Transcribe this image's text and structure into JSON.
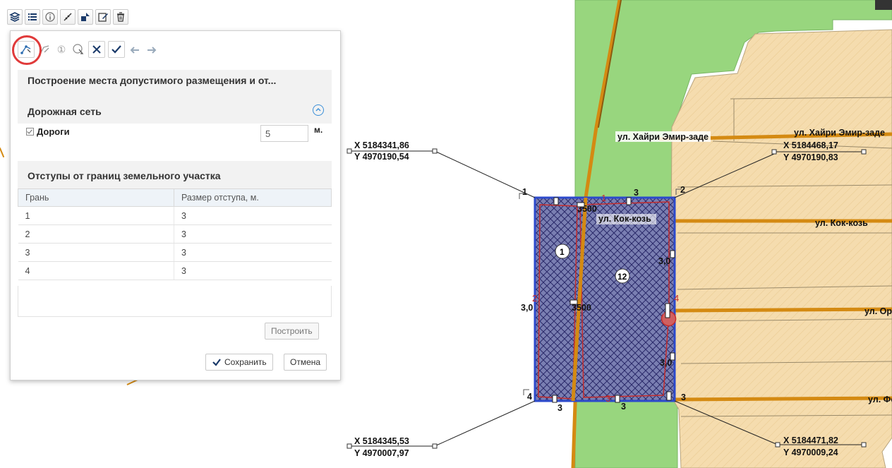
{
  "top_toolbar": {
    "icons": [
      "layers-icon",
      "list-icon",
      "info-icon",
      "measure-icon",
      "object-icon",
      "edit-icon",
      "delete-icon"
    ]
  },
  "edit_toolbar": {
    "icons": [
      "build-contour-icon",
      "edit-contour-icon",
      "number-icon",
      "click-select-icon",
      "close-icon",
      "check-icon",
      "undo-icon",
      "redo-icon"
    ],
    "number_glyph": "①"
  },
  "panel": {
    "title": "Построение места допустимого размещения и от...",
    "road_section": {
      "title": "Дорожная сеть",
      "checkbox_label": "Дороги",
      "value": "5",
      "unit": "м."
    },
    "offsets_section": {
      "title": "Отступы от границ земельного участка",
      "columns": [
        "Грань",
        "Размер отступа, м."
      ],
      "rows": [
        [
          "1",
          "3"
        ],
        [
          "2",
          "3"
        ],
        [
          "3",
          "3"
        ],
        [
          "4",
          "3"
        ]
      ]
    },
    "build_label": "Построить",
    "save_label": "Сохранить",
    "cancel_label": "Отмена"
  },
  "map": {
    "colors": {
      "green_zone": "#98d67e",
      "parcel_fill": "#f5dcae",
      "road": "#d48a12",
      "selection": "#2c4acc",
      "hatch": "#2a2a6a",
      "red_line": "#c42c2c"
    },
    "streets": [
      "ул. Хайри Эмир-заде",
      "ул. Хайри Эмир-заде",
      "ул. Кок-козь",
      "ул. Кок-козь",
      "ул. Ортал",
      "ул. Фонт"
    ],
    "coordinates": [
      {
        "x": "X 5184341,86",
        "y": "Y 4970190,54"
      },
      {
        "x": "X 5184468,17",
        "y": "Y 4970190,83"
      },
      {
        "x": "X 5184345,53",
        "y": "Y 4970007,97"
      },
      {
        "x": "X 5184471,82",
        "y": "Y 4970009,24"
      }
    ],
    "corner_labels": [
      "1",
      "2",
      "3",
      "4"
    ],
    "side_labels": [
      "1",
      "2",
      "3",
      "4"
    ],
    "zone_labels": [
      "1",
      "12"
    ],
    "measures": [
      "3,0",
      "3,0",
      "3,0",
      "3500",
      "3500",
      "3",
      "3",
      "3"
    ]
  }
}
